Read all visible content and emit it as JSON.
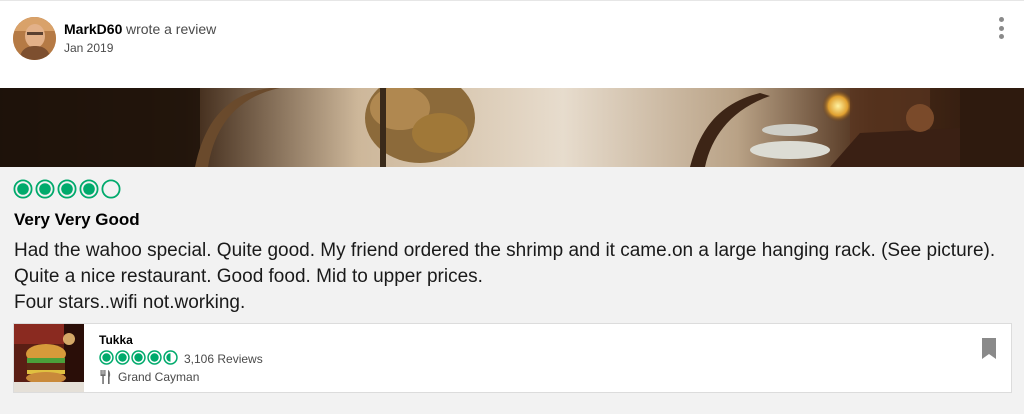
{
  "review": {
    "username": "MarkD60",
    "action": "wrote a review",
    "date": "Jan 2019",
    "rating": 4,
    "rating_max": 5,
    "title": "Very Very Good",
    "body": "Had the wahoo special. Quite good. My friend ordered the shrimp and it came.on a large hanging rack. (See picture). Quite a nice restaurant. Good food. Mid to upper prices.\nFour stars..wifi not.working."
  },
  "place": {
    "name": "Tukka",
    "rating": 4.5,
    "reviews": "3,106 Reviews",
    "location": "Grand Cayman",
    "location_icon": "fork-knife-icon"
  },
  "colors": {
    "bubble": "#00aa6c",
    "background": "#f2f2f2",
    "save_icon": "#8a8a8a"
  }
}
